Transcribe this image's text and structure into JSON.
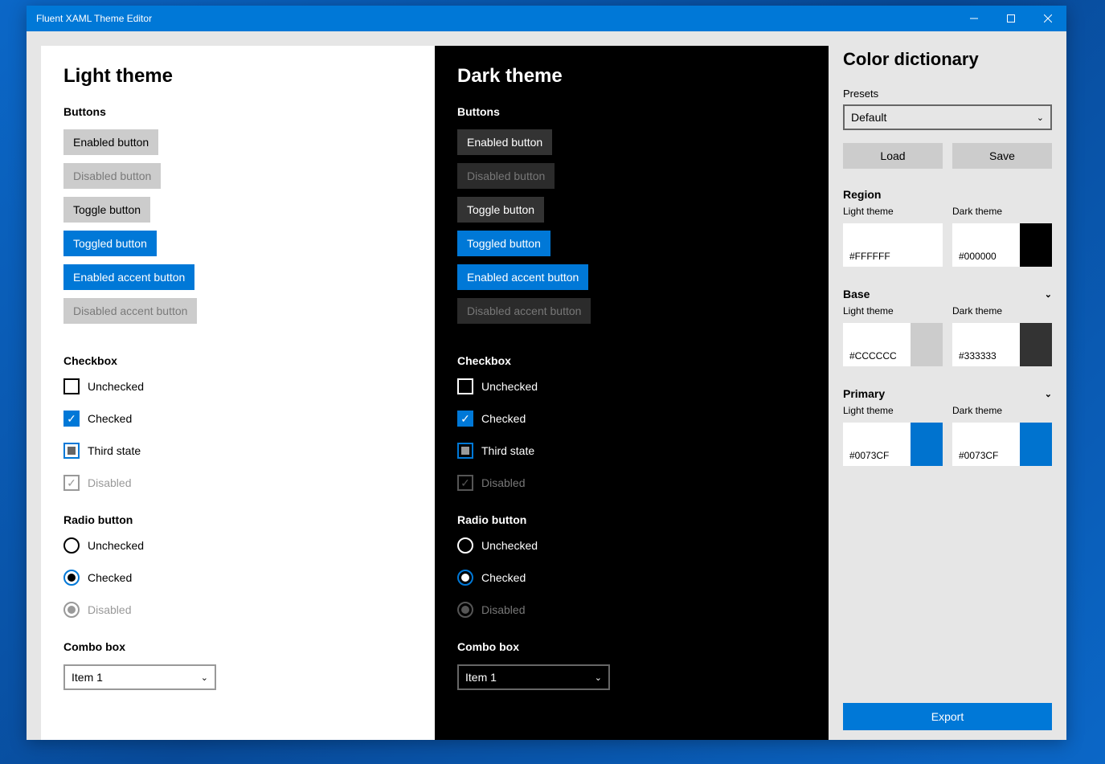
{
  "window": {
    "title": "Fluent XAML Theme Editor"
  },
  "themes": {
    "light": {
      "title": "Light theme"
    },
    "dark": {
      "title": "Dark theme"
    }
  },
  "groups": {
    "buttons": {
      "title": "Buttons",
      "enabled": "Enabled button",
      "disabled": "Disabled button",
      "toggle": "Toggle button",
      "toggled": "Toggled button",
      "accent_enabled": "Enabled accent button",
      "accent_disabled": "Disabled accent button"
    },
    "checkbox": {
      "title": "Checkbox",
      "unchecked": "Unchecked",
      "checked": "Checked",
      "third": "Third state",
      "disabled": "Disabled"
    },
    "radio": {
      "title": "Radio button",
      "unchecked": "Unchecked",
      "checked": "Checked",
      "disabled": "Disabled"
    },
    "combo": {
      "title": "Combo box",
      "selected": "Item 1"
    }
  },
  "side": {
    "title": "Color dictionary",
    "presets_label": "Presets",
    "presets_value": "Default",
    "load": "Load",
    "save": "Save",
    "sections": {
      "region": {
        "title": "Region",
        "light_label": "Light theme",
        "dark_label": "Dark theme",
        "light_hex": "#FFFFFF",
        "dark_hex": "#000000",
        "light_swatch": "#ffffff",
        "dark_swatch": "#000000"
      },
      "base": {
        "title": "Base",
        "light_label": "Light theme",
        "dark_label": "Dark theme",
        "light_hex": "#CCCCCC",
        "dark_hex": "#333333",
        "light_swatch": "#cccccc",
        "dark_swatch": "#333333"
      },
      "primary": {
        "title": "Primary",
        "light_label": "Light theme",
        "dark_label": "Dark theme",
        "light_hex": "#0073CF",
        "dark_hex": "#0073CF",
        "light_swatch": "#0073cf",
        "dark_swatch": "#0073cf"
      }
    },
    "export": "Export"
  }
}
